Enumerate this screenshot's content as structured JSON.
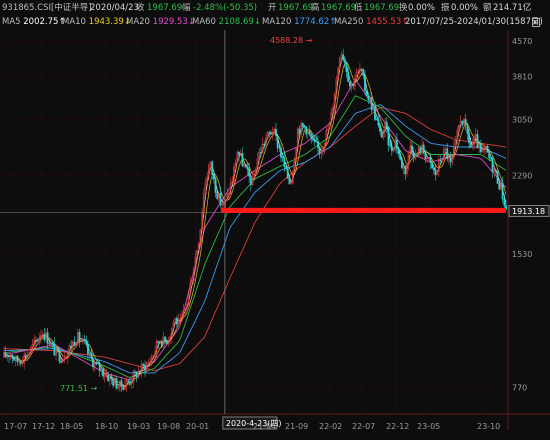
{
  "header": {
    "code": "931865.CSI[中证半导]",
    "date": "2020/04/23",
    "close_label": "收",
    "close_value": "1967.69",
    "change_label": "幅",
    "change_value": "-2.48%(-50.35)",
    "open_label": "开",
    "open_value": "1967.69",
    "high_label": "高",
    "high_value": "1967.69",
    "low_label": "低",
    "low_value": "1967.69",
    "turnover_label": "换",
    "turnover_value": "0.00%",
    "amplitude_label": "振",
    "amplitude_value": "0.00%",
    "amount_label": "额",
    "amount_value": "214.71亿",
    "range": "2017/07/25-2024/01/30(1587日)"
  },
  "ma_bar": [
    {
      "name": "MA5",
      "value": "2002.75",
      "color": "#ffffff"
    },
    {
      "name": "MA10",
      "value": "1943.39",
      "color": "#f0d21e"
    },
    {
      "name": "MA20",
      "value": "1929.53",
      "color": "#e84ad8"
    },
    {
      "name": "MA60",
      "value": "2108.69",
      "color": "#2fbf4a"
    },
    {
      "name": "MA120",
      "value": "1774.62",
      "color": "#3aa0ff"
    },
    {
      "name": "MA250",
      "value": "1455.53",
      "color": "#e8413c"
    }
  ],
  "colors": {
    "up": "#e8413c",
    "down": "#2fd3d3",
    "ma5": "#ffffff",
    "ma10": "#f0d21e",
    "ma20": "#e84ad8",
    "ma60": "#2fbf4a",
    "ma120": "#3aa0ff",
    "ma250": "#e8413c",
    "support": "#ff1a1a",
    "grid": "#3a1414",
    "axis_text": "#9a9a9a"
  },
  "chart_data": {
    "type": "candlestick",
    "scale": "log",
    "ylim": [
      700,
      4640
    ],
    "y_ticks": [
      "4570",
      "3810",
      "3050",
      "2290",
      "1530",
      "770"
    ],
    "x_ticks": [
      "17-07",
      "17-12",
      "18-05",
      "18-10",
      "19-03",
      "19-08",
      "20-01",
      "21-04",
      "21-09",
      "22-02",
      "22-07",
      "22-12",
      "23-05",
      "23-10"
    ],
    "cursor": {
      "date": "2020-4-23(四)",
      "price": 1967.69
    },
    "support_level": {
      "value": 1913.18,
      "label": "1913.18"
    },
    "annotations": [
      {
        "text": "4588.28",
        "value": 4588.28,
        "kind": "max"
      },
      {
        "text": "771.51",
        "value": 771.51,
        "kind": "min"
      }
    ],
    "price_path": {
      "t": [
        0,
        0.012,
        0.025,
        0.045,
        0.06,
        0.075,
        0.09,
        0.1,
        0.115,
        0.13,
        0.145,
        0.16,
        0.17,
        0.185,
        0.2,
        0.215,
        0.23,
        0.245,
        0.26,
        0.275,
        0.29,
        0.3,
        0.31,
        0.32,
        0.33,
        0.34,
        0.35,
        0.36,
        0.365,
        0.372,
        0.38,
        0.39,
        0.4,
        0.41,
        0.42,
        0.43,
        0.44,
        0.455,
        0.465,
        0.475,
        0.485,
        0.495,
        0.505,
        0.52,
        0.535,
        0.55,
        0.56,
        0.57,
        0.575,
        0.585,
        0.6,
        0.615,
        0.63,
        0.64,
        0.65,
        0.66,
        0.67,
        0.68,
        0.69,
        0.7,
        0.71,
        0.72,
        0.73,
        0.74,
        0.75,
        0.76,
        0.77,
        0.78,
        0.79,
        0.8,
        0.81,
        0.82,
        0.83,
        0.84,
        0.85,
        0.86,
        0.87,
        0.88,
        0.89,
        0.9,
        0.91,
        0.92,
        0.93,
        0.94,
        0.95,
        0.96,
        0.97,
        0.98,
        0.99,
        1.0
      ],
      "v": [
        900,
        920,
        880,
        910,
        960,
        1030,
        980,
        930,
        900,
        940,
        1000,
        960,
        900,
        860,
        830,
        800,
        775,
        790,
        820,
        850,
        880,
        930,
        990,
        970,
        1010,
        1100,
        1060,
        1140,
        1200,
        1320,
        1480,
        1700,
        2200,
        2450,
        2180,
        2000,
        1968,
        2250,
        2600,
        2450,
        2300,
        2200,
        2500,
        2750,
        2900,
        2600,
        2350,
        2200,
        2350,
        2900,
        2950,
        2700,
        2600,
        2800,
        3000,
        3600,
        4400,
        4100,
        3600,
        3800,
        3950,
        3550,
        3350,
        3100,
        2800,
        2950,
        2600,
        2750,
        2450,
        2350,
        2700,
        2500,
        2650,
        2550,
        2400,
        2300,
        2500,
        2600,
        2400,
        2700,
        3100,
        2900,
        2650,
        2750,
        2550,
        2600,
        2450,
        2300,
        2150,
        1920
      ]
    },
    "ma_paths": {
      "ma20": {
        "t": [
          0,
          0.1,
          0.2,
          0.25,
          0.3,
          0.35,
          0.4,
          0.45,
          0.5,
          0.55,
          0.6,
          0.65,
          0.7,
          0.75,
          0.8,
          0.85,
          0.9,
          0.95,
          1.0
        ],
        "v": [
          910,
          960,
          830,
          800,
          880,
          1050,
          1750,
          2150,
          2350,
          2550,
          2700,
          3000,
          3750,
          3100,
          2600,
          2450,
          2550,
          2500,
          2150
        ]
      },
      "ma60": {
        "t": [
          0,
          0.1,
          0.2,
          0.25,
          0.3,
          0.35,
          0.4,
          0.45,
          0.5,
          0.55,
          0.6,
          0.65,
          0.7,
          0.75,
          0.8,
          0.85,
          0.9,
          0.95,
          1.0
        ],
        "v": [
          920,
          950,
          860,
          810,
          850,
          980,
          1450,
          1950,
          2250,
          2400,
          2550,
          2800,
          3450,
          3250,
          2800,
          2550,
          2550,
          2550,
          2350
        ]
      },
      "ma120": {
        "t": [
          0,
          0.1,
          0.2,
          0.25,
          0.3,
          0.35,
          0.4,
          0.45,
          0.5,
          0.55,
          0.6,
          0.65,
          0.7,
          0.75,
          0.8,
          0.85,
          0.9,
          0.95,
          1.0
        ],
        "v": [
          930,
          940,
          880,
          830,
          830,
          920,
          1200,
          1750,
          2100,
          2350,
          2450,
          2650,
          3150,
          3300,
          2950,
          2700,
          2650,
          2650,
          2500
        ]
      },
      "ma250": {
        "t": [
          0,
          0.1,
          0.2,
          0.25,
          0.3,
          0.35,
          0.4,
          0.45,
          0.5,
          0.55,
          0.6,
          0.65,
          0.7,
          0.75,
          0.8,
          0.85,
          0.9,
          0.95,
          1.0
        ],
        "v": [
          940,
          930,
          900,
          870,
          840,
          870,
          1000,
          1350,
          1800,
          2200,
          2450,
          2650,
          2950,
          3250,
          3150,
          2900,
          2750,
          2700,
          2650
        ]
      }
    }
  }
}
